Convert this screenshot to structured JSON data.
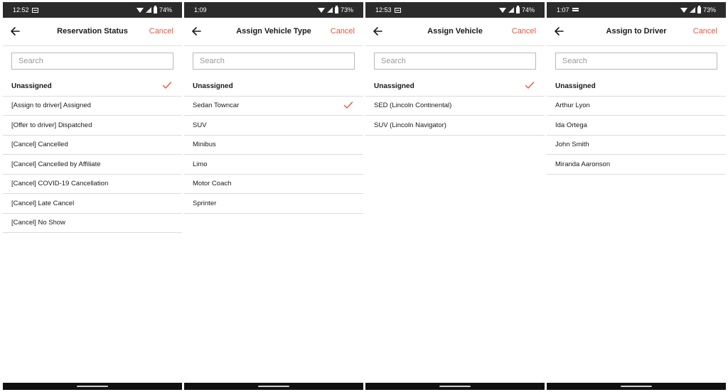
{
  "accent_color": "#e8553d",
  "panels": [
    {
      "status": {
        "time": "12:52",
        "battery": "74%",
        "notif": "mail"
      },
      "title": "Reservation Status",
      "cancel_label": "Cancel",
      "search_placeholder": "Search",
      "items": [
        {
          "label": "Unassigned",
          "bold": true,
          "checked": true
        },
        {
          "label": "[Assign to driver] Assigned",
          "bold": false,
          "checked": false
        },
        {
          "label": "[Offer to driver] Dispatched",
          "bold": false,
          "checked": false
        },
        {
          "label": "[Cancel] Cancelled",
          "bold": false,
          "checked": false
        },
        {
          "label": "[Cancel] Cancelled by Affiliate",
          "bold": false,
          "checked": false
        },
        {
          "label": "[Cancel] COVID-19 Cancellation",
          "bold": false,
          "checked": false
        },
        {
          "label": "[Cancel] Late Cancel",
          "bold": false,
          "checked": false
        },
        {
          "label": "[Cancel] No Show",
          "bold": false,
          "checked": false
        }
      ]
    },
    {
      "status": {
        "time": "1:09",
        "battery": "73%",
        "notif": ""
      },
      "title": "Assign Vehicle Type",
      "cancel_label": "Cancel",
      "search_placeholder": "Search",
      "items": [
        {
          "label": "Unassigned",
          "bold": true,
          "checked": false
        },
        {
          "label": "Sedan Towncar",
          "bold": false,
          "checked": true
        },
        {
          "label": "SUV",
          "bold": false,
          "checked": false
        },
        {
          "label": "Minibus",
          "bold": false,
          "checked": false
        },
        {
          "label": "Limo",
          "bold": false,
          "checked": false
        },
        {
          "label": "Motor Coach",
          "bold": false,
          "checked": false
        },
        {
          "label": "Sprinter",
          "bold": false,
          "checked": false
        }
      ]
    },
    {
      "status": {
        "time": "12:53",
        "battery": "74%",
        "notif": "mail"
      },
      "title": "Assign Vehicle",
      "cancel_label": "Cancel",
      "search_placeholder": "Search",
      "items": [
        {
          "label": "Unassigned",
          "bold": true,
          "checked": true
        },
        {
          "label": "SED (Lincoln Continental)",
          "bold": false,
          "checked": false
        },
        {
          "label": "SUV (Lincoln Navigator)",
          "bold": false,
          "checked": false
        }
      ]
    },
    {
      "status": {
        "time": "1:07",
        "battery": "73%",
        "notif": "bars"
      },
      "title": "Assign to Driver",
      "cancel_label": "Cancel",
      "search_placeholder": "Search",
      "items": [
        {
          "label": "Unassigned",
          "bold": true,
          "checked": false
        },
        {
          "label": "Arthur Lyon",
          "bold": false,
          "checked": false
        },
        {
          "label": "Ida Ortega",
          "bold": false,
          "checked": false
        },
        {
          "label": "John Smith",
          "bold": false,
          "checked": false
        },
        {
          "label": "Miranda Aaronson",
          "bold": false,
          "checked": false
        }
      ]
    }
  ]
}
